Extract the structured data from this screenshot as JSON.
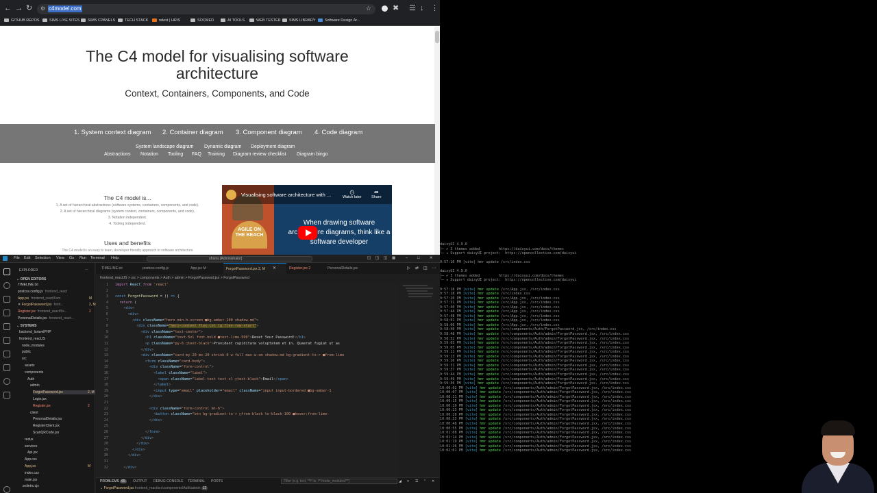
{
  "browser": {
    "url": "c4model.com",
    "bookmarks": [
      "GITHUB REPOS",
      "SIMS LIVE SITES",
      "SIMS CPANELS",
      "TECH STACK",
      "ndest | HRIS",
      "SOCMED",
      "AI TOOLS",
      "WEB TESTER",
      "SIMS LIBRARY",
      "Software Design Ar..."
    ]
  },
  "page": {
    "title": "The C4 model for visualising software architecture",
    "subtitle": "Context, Containers, Components, and Code",
    "nav_main": [
      "1. System context diagram",
      "2. Container diagram",
      "3. Component diagram",
      "4. Code diagram"
    ],
    "nav_sub1": [
      "System landscape diagram",
      "Dynamic diagram",
      "Deployment diagram"
    ],
    "nav_sub2": [
      "Abstractions",
      "Notation",
      "Tooling",
      "FAQ",
      "Training",
      "Diagram review checklist",
      "Diagram bingo"
    ],
    "is_heading": "The C4 model is...",
    "is_items": [
      "1. A set of hierarchical abstractions (software systems, containers, components, and code).",
      "2. A set of hierarchical diagrams (system context, containers, components, and code).",
      "3. Notation independent.",
      "4. Tooling independent."
    ],
    "uses_heading": "Uses and benefits",
    "uses_text": "The C4 model is an easy to learn, developer friendly approach to software architecture",
    "video": {
      "title": "Visualising software architecture with ...",
      "watch_later": "Watch later",
      "share": "Share",
      "text": "When drawing software architecture diagrams, think like a software developer",
      "agile": "AGILE ON THE BEACH"
    }
  },
  "vscode": {
    "menu": [
      "File",
      "Edit",
      "Selection",
      "View",
      "Go",
      "Run",
      "Terminal",
      "Help"
    ],
    "command_center": "sfrsms [Administrator]",
    "explorer_title": "EXPLORER",
    "open_editors": "OPEN EDITORS",
    "open_files": [
      {
        "name": "TIMELINE.txt",
        "path": "",
        "status": ""
      },
      {
        "name": "postcss.config.js",
        "path": "frontend_react",
        "status": ""
      },
      {
        "name": "App.jsx",
        "path": "frontend_react3\\src",
        "status": "M"
      },
      {
        "name": "ForgotPassword.jsx",
        "path": "front...",
        "status": "2, M"
      },
      {
        "name": "Register.jsx",
        "path": "frontend_react3\\s...",
        "status": "2"
      },
      {
        "name": "PersonalDetails.jsx",
        "path": "frontend_react...",
        "status": ""
      }
    ],
    "workspace": "SYSTEMS",
    "tree": [
      {
        "label": "backend_laravelPHP",
        "indent": 1,
        "status": ""
      },
      {
        "label": "frontend_reactJS",
        "indent": 1,
        "status": ""
      },
      {
        "label": "node_modules",
        "indent": 2,
        "status": ""
      },
      {
        "label": "public",
        "indent": 2,
        "status": ""
      },
      {
        "label": "src",
        "indent": 2,
        "status": ""
      },
      {
        "label": "assets",
        "indent": 3,
        "status": ""
      },
      {
        "label": "components",
        "indent": 3,
        "status": ""
      },
      {
        "label": "Auth",
        "indent": 4,
        "status": ""
      },
      {
        "label": "admin",
        "indent": 5,
        "status": ""
      },
      {
        "label": "ForgotPassword.jsx",
        "indent": 6,
        "status": "2, M"
      },
      {
        "label": "Login.jsx",
        "indent": 6,
        "status": ""
      },
      {
        "label": "Register.jsx",
        "indent": 6,
        "status": "2"
      },
      {
        "label": "client",
        "indent": 5,
        "status": ""
      },
      {
        "label": "PersonalDetails.jsx",
        "indent": 6,
        "status": ""
      },
      {
        "label": "RegisterClient.jsx",
        "indent": 6,
        "status": ""
      },
      {
        "label": "ScanQRCode.jsx",
        "indent": 6,
        "status": ""
      },
      {
        "label": "redux",
        "indent": 3,
        "status": ""
      },
      {
        "label": "services",
        "indent": 3,
        "status": ""
      },
      {
        "label": "Api.jsx",
        "indent": 4,
        "status": ""
      },
      {
        "label": "App.css",
        "indent": 3,
        "status": ""
      },
      {
        "label": "App.jsx",
        "indent": 3,
        "status": "M"
      },
      {
        "label": "index.css",
        "indent": 3,
        "status": ""
      },
      {
        "label": "main.jsx",
        "indent": 3,
        "status": ""
      },
      {
        "label": ".eslintrc.cjs",
        "indent": 2,
        "status": ""
      }
    ],
    "tabs": [
      "TIMELINE.txt",
      "postcss.config.js",
      "App.jsx M",
      "ForgotPassword.jsx 2, M",
      "Register.jsx 2",
      "PersonalDetails.jsx"
    ],
    "breadcrumbs": "frontend_reactJS > src > components > Auth > admin > ForgotPassword.jsx > ForgotPassword",
    "panel": [
      "PROBLEMS",
      "OUTPUT",
      "DEBUG CONSOLE",
      "TERMINAL",
      "PORTS"
    ],
    "problems_count": "65",
    "filter_placeholder": "Filter (e.g. text, **/*.ts, !**/node_modules/**)",
    "panel_file": "ForgotPassword.jsx",
    "panel_file_path": "frontend_react\\src\\components\\Auth\\admin",
    "panel_file_count": "12"
  },
  "terminal": {
    "header": [
      "daisyUI 4.9.0",
      "├─ ✔ 3 themes added         https://daisyui.com/docs/themes",
      "╰─ ★ Support daisyUI project:  https://opencollective.com/daisyui",
      "",
      "9:57:16 PM [vite] hmr update /src/index.css",
      "",
      "daisyUI 4.9.0",
      "├─ ✔ 3 themes added         https://daisyui.com/docs/themes",
      "╰─ ★ Support daisyUI project:  https://opencollective.com/daisyui",
      ""
    ],
    "updates": [
      {
        "time": "9:57:18 PM",
        "file": "/src/App.jsx, /src/index.css"
      },
      {
        "time": "9:57:18 PM",
        "file": "/src/index.css"
      },
      {
        "time": "9:57:26 PM",
        "file": "/src/App.jsx, /src/index.css"
      },
      {
        "time": "9:57:31 PM",
        "file": "/src/App.jsx, /src/index.css"
      },
      {
        "time": "9:57:40 PM",
        "file": "/src/App.jsx, /src/index.css"
      },
      {
        "time": "9:57:44 PM",
        "file": "/src/App.jsx, /src/index.css"
      },
      {
        "time": "9:57:48 PM",
        "file": "/src/App.jsx, /src/index.css"
      },
      {
        "time": "9:58:01 PM",
        "file": "/src/App.jsx, /src/index.css"
      },
      {
        "time": "9:58:06 PM",
        "file": "/src/App.jsx, /src/index.css"
      },
      {
        "time": "9:58:40 PM",
        "file": "/src/components/Auth/ForgotPassword.jsx, /src/index.css"
      },
      {
        "time": "9:58:48 PM",
        "file": "/src/components/Auth/admin/ForgotPassword.jsx, /src/index.css"
      },
      {
        "time": "9:58:52 PM",
        "file": "/src/components/Auth/admin/ForgotPassword.jsx, /src/index.css"
      },
      {
        "time": "9:59:03 PM",
        "file": "/src/components/Auth/admin/ForgotPassword.jsx, /src/index.css"
      },
      {
        "time": "9:59:05 PM",
        "file": "/src/components/Auth/admin/ForgotPassword.jsx, /src/index.css"
      },
      {
        "time": "9:59:11 PM",
        "file": "/src/components/Auth/admin/ForgotPassword.jsx, /src/index.css"
      },
      {
        "time": "9:59:13 PM",
        "file": "/src/components/Auth/admin/ForgotPassword.jsx, /src/index.css"
      },
      {
        "time": "9:59:26 PM",
        "file": "/src/components/Auth/admin/ForgotPassword.jsx, /src/index.css"
      },
      {
        "time": "9:59:31 PM",
        "file": "/src/components/Auth/admin/ForgotPassword.jsx, /src/index.css"
      },
      {
        "time": "9:59:37 PM",
        "file": "/src/components/Auth/admin/ForgotPassword.jsx, /src/index.css"
      },
      {
        "time": "9:59:44 PM",
        "file": "/src/components/Auth/admin/ForgotPassword.jsx, /src/index.css"
      },
      {
        "time": "9:59:49 PM",
        "file": "/src/components/Auth/admin/ForgotPassword.jsx, /src/index.css"
      },
      {
        "time": "9:59:56 PM",
        "file": "/src/components/Auth/admin/ForgotPassword.jsx, /src/index.css"
      },
      {
        "time": "10:00:02 PM",
        "file": "/src/components/Auth/admin/ForgotPassword.jsx, /src/index.css"
      },
      {
        "time": "10:00:07 PM",
        "file": "/src/components/Auth/admin/ForgotPassword.jsx, /src/index.css"
      },
      {
        "time": "10:00:11 PM",
        "file": "/src/components/Auth/admin/ForgotPassword.jsx, /src/index.css"
      },
      {
        "time": "10:00:15 PM",
        "file": "/src/components/Auth/admin/ForgotPassword.jsx, /src/index.css"
      },
      {
        "time": "10:00:19 PM",
        "file": "/src/components/Auth/admin/ForgotPassword.jsx, /src/index.css"
      },
      {
        "time": "10:00:23 PM",
        "file": "/src/components/Auth/admin/ForgotPassword.jsx, /src/index.css"
      },
      {
        "time": "10:00:28 PM",
        "file": "/src/components/Auth/admin/ForgotPassword.jsx, /src/index.css"
      },
      {
        "time": "10:00:33 PM",
        "file": "/src/components/Auth/admin/ForgotPassword.jsx, /src/index.css"
      },
      {
        "time": "10:00:48 PM",
        "file": "/src/components/Auth/admin/ForgotPassword.jsx, /src/index.css"
      },
      {
        "time": "10:00:55 PM",
        "file": "/src/components/Auth/admin/ForgotPassword.jsx, /src/index.css"
      },
      {
        "time": "10:01:08 PM",
        "file": "/src/components/Auth/admin/ForgotPassword.jsx, /src/index.css"
      },
      {
        "time": "10:01:14 PM",
        "file": "/src/components/Auth/admin/ForgotPassword.jsx, /src/index.css"
      },
      {
        "time": "10:01:19 PM",
        "file": "/src/components/Auth/admin/ForgotPassword.jsx, /src/index.css"
      },
      {
        "time": "10:01:26 PM",
        "file": "/src/components/Auth/admin/ForgotPassword.jsx, /src/index.css"
      },
      {
        "time": "10:02:01 PM",
        "file": "/src/components/Auth/admin/ForgotPassword.jsx, /src/index.css"
      }
    ]
  }
}
